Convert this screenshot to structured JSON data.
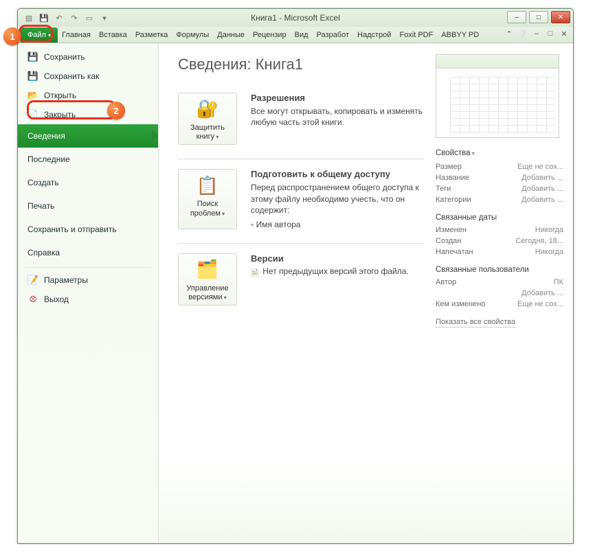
{
  "title": "Книга1  -  Microsoft Excel",
  "qat": [
    "excel",
    "save",
    "undo",
    "redo",
    "print",
    "custom"
  ],
  "winbtns": {
    "min": "–",
    "max": "□",
    "close": "✕"
  },
  "ribbon": {
    "file": "Файл",
    "tabs": [
      "Главная",
      "Вставка",
      "Разметка",
      "Формулы",
      "Данные",
      "Рецензир",
      "Вид",
      "Разработ",
      "Надстрой",
      "Foxit PDF",
      "ABBYY PD"
    ]
  },
  "markers": {
    "one": "1",
    "two": "2"
  },
  "left": {
    "save": "Сохранить",
    "saveas": "Сохранить как",
    "open": "Открыть",
    "close": "Закрыть",
    "info": "Сведения",
    "recent": "Последние",
    "new": "Создать",
    "print": "Печать",
    "saveSend": "Сохранить и отправить",
    "help": "Справка",
    "options": "Параметры",
    "exit": "Выход"
  },
  "page": {
    "title": "Сведения: Книга1",
    "permissions": {
      "btn": "Защитить книгу",
      "head": "Разрешения",
      "body": "Все могут открывать, копировать и изменять любую часть этой книги."
    },
    "prepare": {
      "btn": "Поиск проблем",
      "head": "Подготовить к общему доступу",
      "body": "Перед распространением общего доступа к этому файлу необходимо учесть, что он содержит:",
      "bullet": "Имя автора"
    },
    "versions": {
      "btn": "Управление версиями",
      "head": "Версии",
      "body": "Нет предыдущих версий этого файла."
    }
  },
  "props": {
    "heading": "Свойства",
    "rows": [
      {
        "k": "Размер",
        "v": "Еще не сох..."
      },
      {
        "k": "Название",
        "v": "Добавить ..."
      },
      {
        "k": "Теги",
        "v": "Добавить ..."
      },
      {
        "k": "Категории",
        "v": "Добавить ..."
      }
    ],
    "datesHead": "Связанные даты",
    "dates": [
      {
        "k": "Изменен",
        "v": "Никогда"
      },
      {
        "k": "Создан",
        "v": "Сегодня, 18..."
      },
      {
        "k": "Напечатан",
        "v": "Никогда"
      }
    ],
    "peopleHead": "Связанные пользователи",
    "people": [
      {
        "k": "Автор",
        "v": "ПК"
      },
      {
        "k": "",
        "v": "Добавить ..."
      },
      {
        "k": "Кем изменено",
        "v": "Еще не сох..."
      }
    ],
    "showAll": "Показать все свойства"
  }
}
